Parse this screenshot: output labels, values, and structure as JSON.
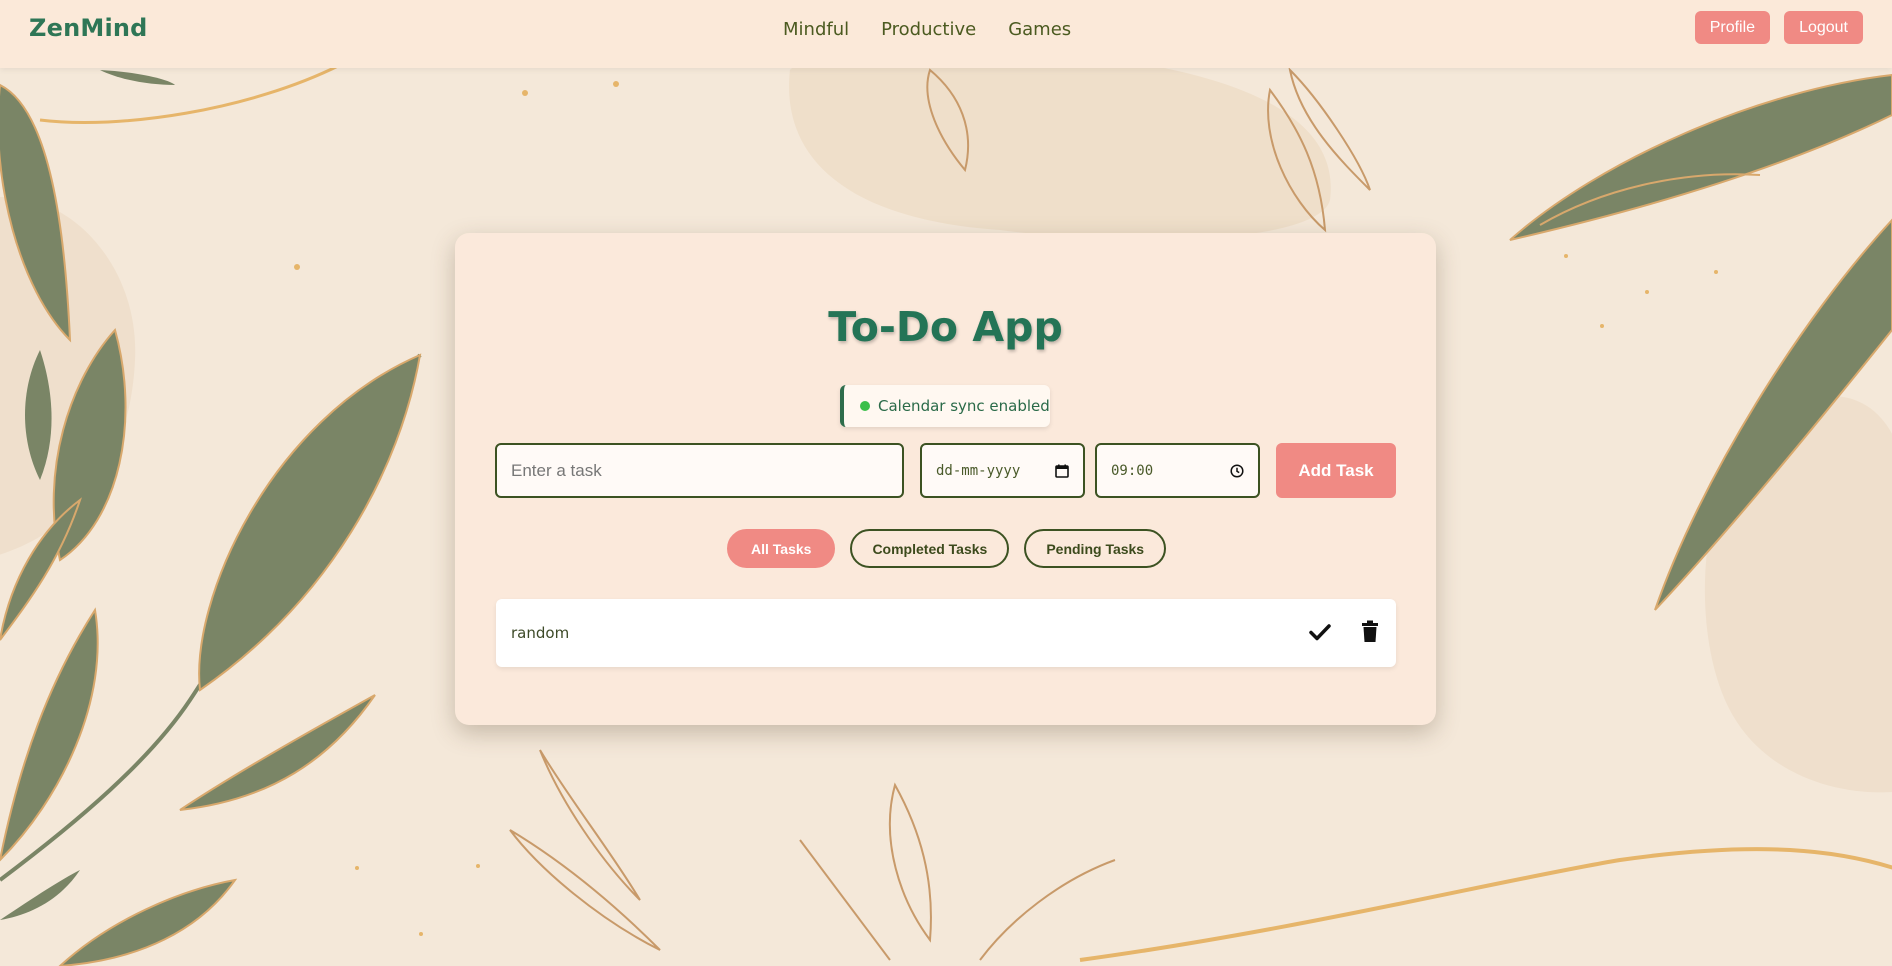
{
  "navbar": {
    "brand": "ZenMind",
    "links": [
      "Mindful",
      "Productive",
      "Games"
    ],
    "profile_label": "Profile",
    "logout_label": "Logout"
  },
  "app": {
    "title": "To-Do App",
    "sync_status": "Calendar sync enabled",
    "task_placeholder": "Enter a task",
    "date_placeholder": "dd-mm-yyyy",
    "time_value": "09:00",
    "add_label": "Add Task",
    "filters": [
      "All Tasks",
      "Completed Tasks",
      "Pending Tasks"
    ],
    "active_filter": "All Tasks",
    "tasks": [
      {
        "text": "random"
      }
    ]
  },
  "colors": {
    "brand_green": "#2e7656",
    "accent_coral": "#f08a84",
    "leaf_green": "#7a8566",
    "gold": "#e6b56a",
    "background": "#f4e8d9"
  }
}
